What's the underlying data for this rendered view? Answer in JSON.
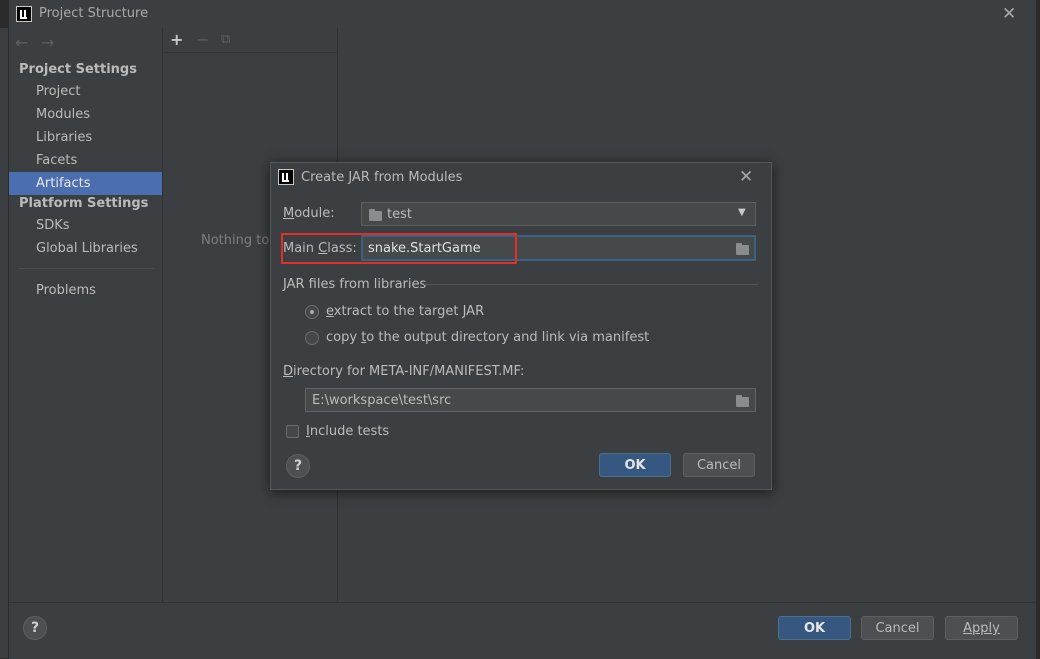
{
  "window": {
    "title": "Project Structure"
  },
  "sidebar": {
    "project_settings_header": "Project Settings",
    "platform_settings_header": "Platform Settings",
    "items": {
      "project": "Project",
      "modules": "Modules",
      "libraries": "Libraries",
      "facets": "Facets",
      "artifacts": "Artifacts",
      "sdks": "SDKs",
      "global_libraries": "Global Libraries",
      "problems": "Problems"
    },
    "selected": "Artifacts"
  },
  "middle": {
    "empty_text": "Nothing to s"
  },
  "bottom": {
    "help": "?",
    "ok": "OK",
    "cancel": "Cancel",
    "apply": "Apply"
  },
  "dialog": {
    "title": "Create JAR from Modules",
    "module_label_u": "M",
    "module_label_rest": "odule:",
    "module_value": "test",
    "main_class_label_pre": "Main ",
    "main_class_label_u": "C",
    "main_class_label_post": "lass:",
    "main_class_value": "snake.StartGame",
    "jar_section": "JAR files from libraries",
    "radio_extract_u": "e",
    "radio_extract_rest": "xtract to the target JAR",
    "radio_copy_pre": "copy ",
    "radio_copy_u": "t",
    "radio_copy_rest": "o the output directory and link via manifest",
    "manifest_label_u": "D",
    "manifest_label_rest": "irectory for META-INF/MANIFEST.MF:",
    "manifest_value": "E:\\workspace\\test\\src",
    "include_tests_u": "I",
    "include_tests_rest": "nclude tests",
    "help": "?",
    "ok": "OK",
    "cancel": "Cancel"
  },
  "colors": {
    "selection": "#4b6eaf",
    "primary_button": "#365880",
    "highlight": "#e0302c",
    "background": "#3c3f41"
  }
}
